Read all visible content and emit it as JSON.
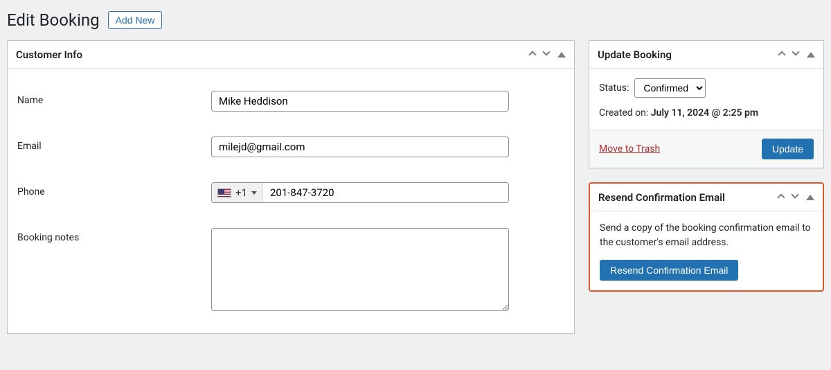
{
  "page": {
    "title": "Edit Booking",
    "add_new_label": "Add New"
  },
  "customer_info": {
    "heading": "Customer Info",
    "fields": {
      "name": {
        "label": "Name",
        "value": "Mike Heddison"
      },
      "email": {
        "label": "Email",
        "value": "milejd@gmail.com"
      },
      "phone": {
        "label": "Phone",
        "country_code": "+1",
        "value": "201-847-3720"
      },
      "notes": {
        "label": "Booking notes",
        "value": ""
      }
    }
  },
  "update_booking": {
    "heading": "Update Booking",
    "status_label": "Status:",
    "status_value": "Confirmed",
    "created_label": "Created on:",
    "created_value": "July 11, 2024 @ 2:25 pm",
    "trash_label": "Move to Trash",
    "update_button": "Update"
  },
  "resend": {
    "heading": "Resend Confirmation Email",
    "description": "Send a copy of the booking confirmation email to the customer's email address.",
    "button": "Resend Confirmation Email"
  }
}
